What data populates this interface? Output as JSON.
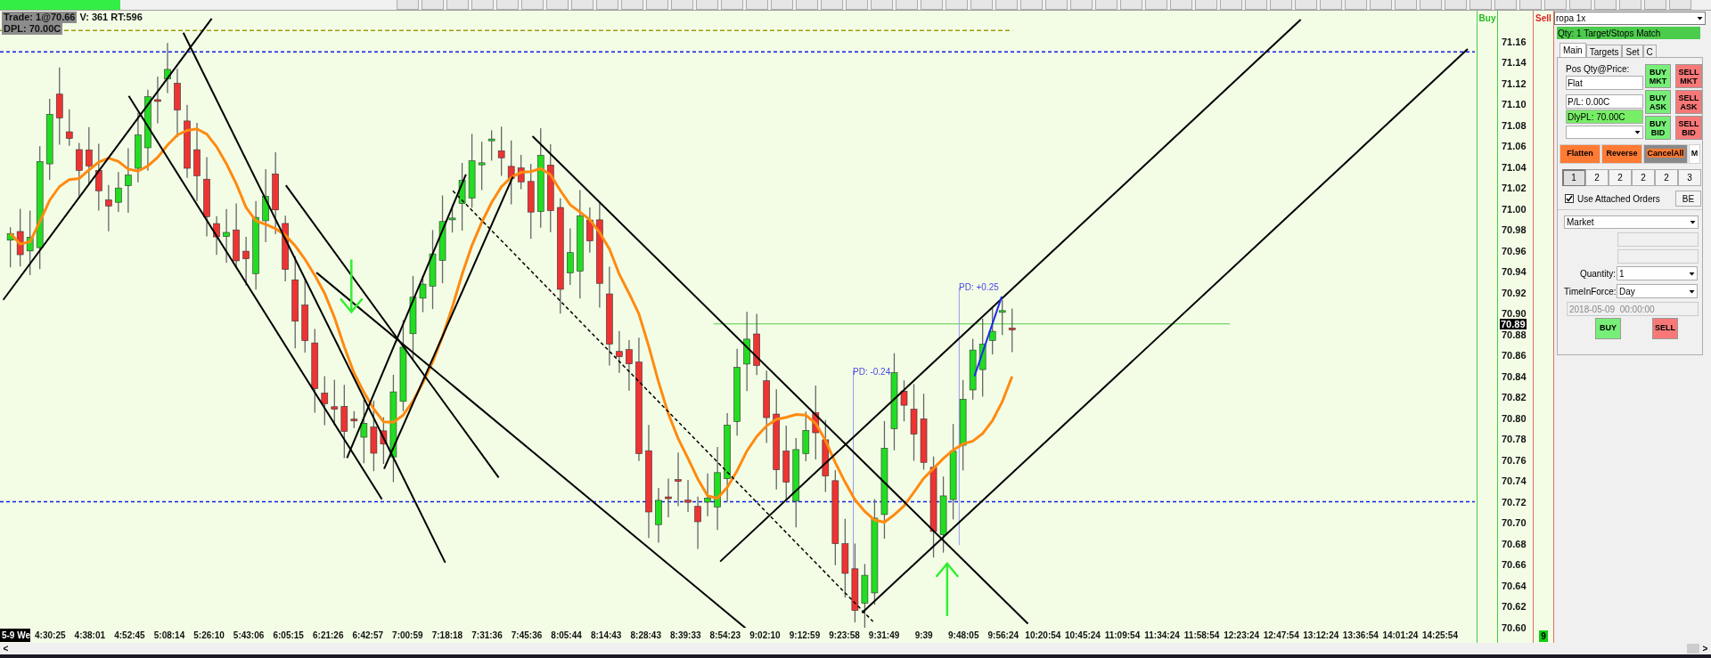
{
  "info_box": {
    "trade": "Trade: 1@70.66",
    "volume": "V: 361 RT:596",
    "daily_pl": "DPL: 70.00C"
  },
  "chart": {
    "annotations": [
      {
        "text": "PD: -0.24"
      },
      {
        "text": "PD: +0.25"
      }
    ]
  },
  "columns": {
    "buy": "Buy",
    "sell": "Sell",
    "sell_count": "9"
  },
  "price_axis": {
    "labels": [
      "71.16",
      "71.14",
      "71.12",
      "71.10",
      "71.08",
      "71.06",
      "71.04",
      "71.02",
      "71.00",
      "70.98",
      "70.96",
      "70.94",
      "70.92",
      "70.90",
      "70.88",
      "70.86",
      "70.84",
      "70.82",
      "70.80",
      "70.78",
      "70.76",
      "70.74",
      "70.72",
      "70.70",
      "70.68",
      "70.66",
      "70.64",
      "70.62",
      "70.60"
    ],
    "current_price": "70.89"
  },
  "time_axis": {
    "date": "5-9 We",
    "labels": [
      "4:30:25",
      "4:38:01",
      "4:52:45",
      "5:08:14",
      "5:26:10",
      "5:43:06",
      "6:05:15",
      "6:21:26",
      "6:42:57",
      "7:00:59",
      "7:18:18",
      "7:31:36",
      "7:45:36",
      "8:05:44",
      "8:14:43",
      "8:28:43",
      "8:39:33",
      "8:54:23",
      "9:02:10",
      "9:12:59",
      "9:23:58",
      "9:31:49",
      "9:39",
      "9:48:05",
      "9:56:24",
      "10:20:54",
      "10:45:24",
      "11:09:54",
      "11:34:24",
      "11:58:54",
      "12:23:24",
      "12:47:54",
      "13:12:24",
      "13:36:54",
      "14:01:24",
      "14:25:54"
    ]
  },
  "scrollbar": {
    "left": "<",
    "right": ">"
  },
  "order_panel": {
    "account": "ropa 1x",
    "status": "Qty: 1 Target/Stops Match",
    "tabs": [
      {
        "label": "Main",
        "selected": true
      },
      {
        "label": "Targets",
        "selected": false
      },
      {
        "label": "Set",
        "selected": false
      },
      {
        "label": "C",
        "selected": false
      }
    ],
    "position_label": "Pos Qty@Price:",
    "fields": [
      {
        "value": "Flat",
        "highlighted": false
      },
      {
        "value": "P/L: 0.00C",
        "highlighted": false
      },
      {
        "value": "DlyPL: 70.00C",
        "highlighted": true
      }
    ],
    "buy_buttons": [
      "BUY MKT",
      "BUY ASK",
      "BUY BID"
    ],
    "sell_buttons": [
      "SELL MKT",
      "SELL ASK",
      "SELL BID"
    ],
    "actions": [
      {
        "label": "Flatten",
        "kind": "orange"
      },
      {
        "label": "Reverse",
        "kind": "orange"
      },
      {
        "label": "CancelAll",
        "kind": "cancel"
      },
      {
        "label": "M",
        "kind": "plain"
      }
    ],
    "quantity_tabs": [
      {
        "label": "1",
        "selected": true
      },
      {
        "label": "2",
        "selected": false
      },
      {
        "label": "2",
        "selected": false
      },
      {
        "label": "2",
        "selected": false
      },
      {
        "label": "2",
        "selected": false
      },
      {
        "label": "3",
        "selected": false
      }
    ],
    "attached_orders": {
      "label": "Use Attached Orders",
      "checked": true
    },
    "be_button": "BE",
    "order_type": "Market",
    "quantity": {
      "label": "Quantity:",
      "value": "1"
    },
    "time_in_force": {
      "label": "TimeInForce:",
      "value": "Day"
    },
    "expiry": {
      "value": "2018-05-09  00:00:00",
      "disabled": true
    },
    "submit_buttons": [
      {
        "label": "BUY",
        "kind": "buy"
      },
      {
        "label": "SELL",
        "kind": "sell"
      }
    ]
  }
}
